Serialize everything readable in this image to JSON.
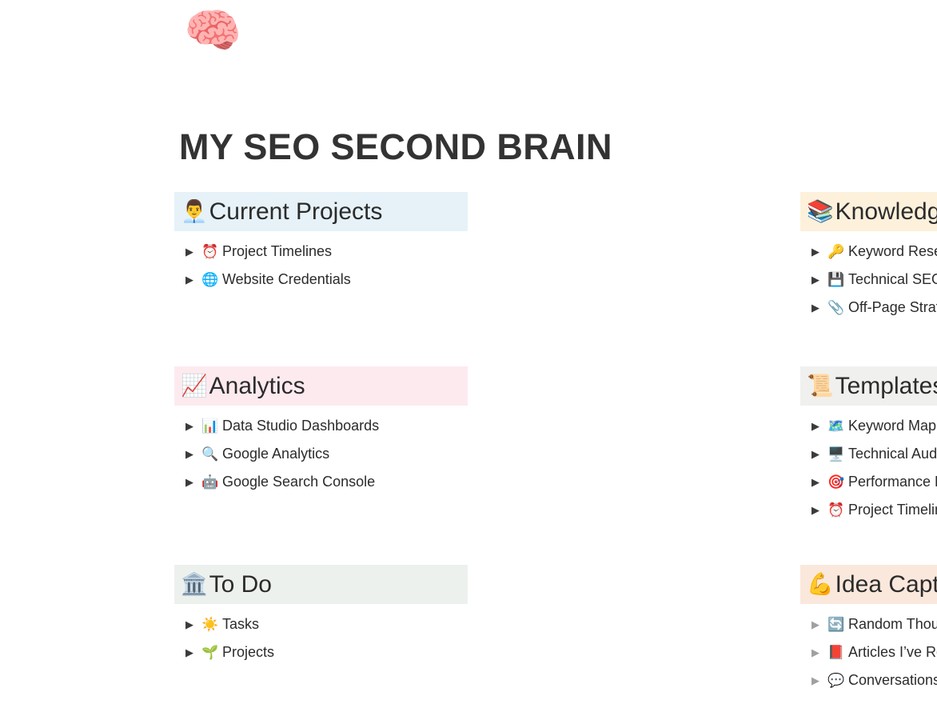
{
  "header": {
    "brain_icon": "🧠",
    "title": "MY SEO SECOND BRAIN"
  },
  "colors": {
    "current_projects_header_bg": "#e6f2f8",
    "knowledge_hub_header_bg": "#fdf1dc",
    "analytics_header_bg": "#fdeaef",
    "templates_header_bg": "#f0f0ef",
    "todo_header_bg": "#edf1ed",
    "idea_capturing_header_bg": "#fbe8dc",
    "title_color": "#333333",
    "text_color": "#2b2b2b",
    "toggle_color": "#3b3b3b",
    "toggle_light_color": "#a0a0a0"
  },
  "toggle_glyph": "▶",
  "sections": [
    {
      "id": "current-projects",
      "emoji": "👨‍💼",
      "emoji_name": "businessman-icon",
      "title": "Current Projects",
      "toggle_style": "dark",
      "items": [
        {
          "emoji": "⏰",
          "emoji_name": "alarm-clock-icon",
          "label": "Project Timelines"
        },
        {
          "emoji": "🌐",
          "emoji_name": "globe-icon",
          "label": "Website Credentials"
        }
      ]
    },
    {
      "id": "knowledge-hub",
      "emoji": "📚",
      "emoji_name": "books-icon",
      "title": "Knowledge Hub",
      "toggle_style": "dark",
      "items": [
        {
          "emoji": "🔑",
          "emoji_name": "key-icon",
          "label": "Keyword Research"
        },
        {
          "emoji": "💾",
          "emoji_name": "floppy-disk-icon",
          "label": "Technical SEO"
        },
        {
          "emoji": "📎",
          "emoji_name": "paperclip-icon",
          "label": "Off-Page Strategy"
        }
      ]
    },
    {
      "id": "analytics",
      "emoji": "📈",
      "emoji_name": "chart-increasing-icon",
      "title": "Analytics",
      "toggle_style": "dark",
      "items": [
        {
          "emoji": "📊",
          "emoji_name": "bar-chart-icon",
          "label": "Data Studio Dashboards"
        },
        {
          "emoji": "🔍",
          "emoji_name": "magnifying-glass-icon",
          "label": "Google Analytics"
        },
        {
          "emoji": "🤖",
          "emoji_name": "robot-icon",
          "label": "Google Search Console"
        }
      ]
    },
    {
      "id": "templates",
      "emoji": "📜",
      "emoji_name": "scroll-icon",
      "title": "Templates",
      "toggle_style": "dark",
      "items": [
        {
          "emoji": "🗺️",
          "emoji_name": "map-icon",
          "label": "Keyword Mapping"
        },
        {
          "emoji": "🖥️",
          "emoji_name": "desktop-computer-icon",
          "label": "Technical Audit Checklist"
        },
        {
          "emoji": "🎯",
          "emoji_name": "target-icon",
          "label": "Performance Reports"
        },
        {
          "emoji": "⏰",
          "emoji_name": "alarm-clock-icon",
          "label": "Project Timeline"
        }
      ]
    },
    {
      "id": "to-do",
      "emoji": "🏛️",
      "emoji_name": "classical-building-icon",
      "title": "To Do",
      "toggle_style": "dark",
      "items": [
        {
          "emoji": "☀️",
          "emoji_name": "sun-icon",
          "label": "Tasks"
        },
        {
          "emoji": "🌱",
          "emoji_name": "seedling-icon",
          "label": "Projects"
        }
      ]
    },
    {
      "id": "idea-capturing",
      "emoji": "💪",
      "emoji_name": "flexed-biceps-icon",
      "title": "Idea Capturing",
      "toggle_style": "light",
      "items": [
        {
          "emoji": "🔄",
          "emoji_name": "refresh-icon",
          "label": "Random Thoughts"
        },
        {
          "emoji": "📕",
          "emoji_name": "closed-book-icon",
          "label": "Articles I’ve Read"
        },
        {
          "emoji": "💬",
          "emoji_name": "speech-balloon-icon",
          "label": "Conversations & Meeting Notes"
        }
      ]
    }
  ]
}
